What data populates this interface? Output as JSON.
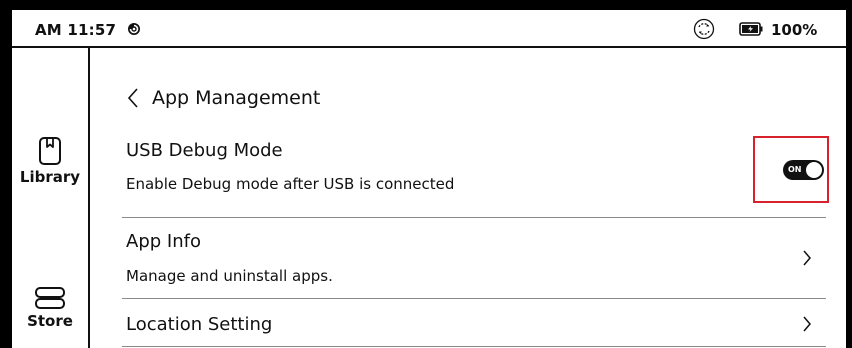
{
  "status_bar": {
    "time": "AM 11:57",
    "battery": "100%",
    "notification_icon": "notification-icon",
    "sync_icon": "sync-icon",
    "battery_icon": "battery-icon"
  },
  "sidebar": {
    "items": [
      {
        "label": "Library",
        "icon": "book-icon"
      },
      {
        "label": "Store",
        "icon": "store-icon"
      }
    ]
  },
  "header": {
    "title": "App Management",
    "back_icon": "back-chevron-icon"
  },
  "settings": [
    {
      "title": "USB Debug Mode",
      "subtitle": "Enable Debug mode after USB is connected",
      "control": "toggle",
      "toggle_state": "ON"
    },
    {
      "title": "App Info",
      "subtitle": "Manage and uninstall apps.",
      "control": "chevron-right-icon"
    },
    {
      "title": "Location Setting",
      "control": "chevron-right-icon"
    }
  ],
  "colors": {
    "highlight": "#d7222d",
    "text": "#111111",
    "divider": "#8a8a8a"
  }
}
